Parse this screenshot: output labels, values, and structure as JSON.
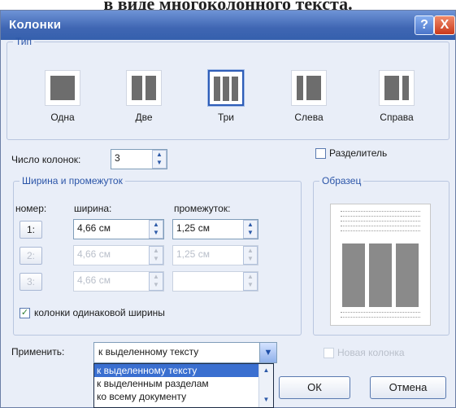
{
  "background_text": "в виде многоколонного текста.",
  "dialog": {
    "title": "Колонки",
    "help_label": "?",
    "close_label": "X",
    "type_group": {
      "legend": "Тип",
      "options": [
        {
          "label": "Одна",
          "selected": false
        },
        {
          "label": "Две",
          "selected": false
        },
        {
          "label": "Три",
          "selected": true
        },
        {
          "label": "Слева",
          "selected": false
        },
        {
          "label": "Справа",
          "selected": false
        }
      ]
    },
    "num_columns": {
      "label": "Число колонок:",
      "value": "3"
    },
    "separator": {
      "label": "Разделитель",
      "checked": false
    },
    "widths_group": {
      "legend": "Ширина и промежуток",
      "headers": {
        "number": "номер:",
        "width": "ширина:",
        "spacing": "промежуток:"
      },
      "rows": [
        {
          "number": "1:",
          "width": "4,66 см",
          "spacing": "1,25 см",
          "enabled": true
        },
        {
          "number": "2:",
          "width": "4,66 см",
          "spacing": "1,25 см",
          "enabled": false
        },
        {
          "number": "3:",
          "width": "4,66 см",
          "spacing": "",
          "enabled": false
        }
      ],
      "equal_width": {
        "label": "колонки одинаковой ширины",
        "checked": true
      }
    },
    "sample_group": {
      "legend": "Образец"
    },
    "apply": {
      "label": "Применить:",
      "value": "к выделенному тексту",
      "options": [
        "к выделенному тексту",
        "к выделенным разделам",
        "ко всему документу"
      ],
      "highlighted_index": 0
    },
    "new_column": {
      "label": "Новая колонка",
      "checked": false,
      "enabled": false
    },
    "ok_label": "ОК",
    "cancel_label": "Отмена"
  }
}
